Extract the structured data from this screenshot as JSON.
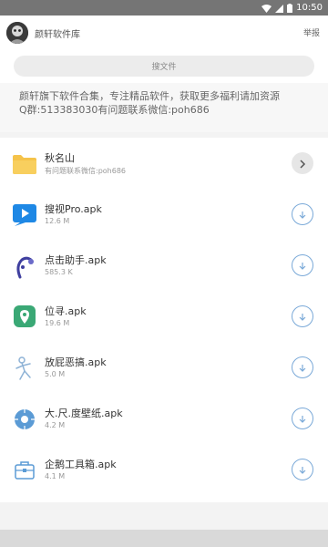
{
  "status_bar": {
    "time": "10:50"
  },
  "header": {
    "title": "颜轩软件库",
    "report_label": "举报"
  },
  "search": {
    "placeholder": "搜文件"
  },
  "notice": {
    "line1": "颜轩旗下软件合集，专注精品软件，获取更多福利请加资源",
    "line2": "Q群:513383030有问题联系微信:poh686"
  },
  "folder": {
    "name": "秋名山",
    "note": "有问题联系微信:poh686",
    "icon": "folder-icon"
  },
  "files": [
    {
      "name": "搜视Pro.apk",
      "size": "12.6 M",
      "icon": "video-player-icon",
      "color": "#1e88e5"
    },
    {
      "name": "点击助手.apk",
      "size": "585.3 K",
      "icon": "click-assistant-icon",
      "color": "#3f3f9f"
    },
    {
      "name": "位寻.apk",
      "size": "19.6 M",
      "icon": "location-pin-icon",
      "color": "#3aa875"
    },
    {
      "name": "放屁恶搞.apk",
      "size": "5.0 M",
      "icon": "prank-figure-icon",
      "color": "#8fb3d6"
    },
    {
      "name": "大.尺.度壁纸.apk",
      "size": "4.2 M",
      "icon": "wallpaper-flower-icon",
      "color": "#5b9bd5"
    },
    {
      "name": "企鹅工具箱.apk",
      "size": "4.1 M",
      "icon": "toolbox-icon",
      "color": "#5b9bd5"
    }
  ],
  "accent_color": "#7aa9d8"
}
